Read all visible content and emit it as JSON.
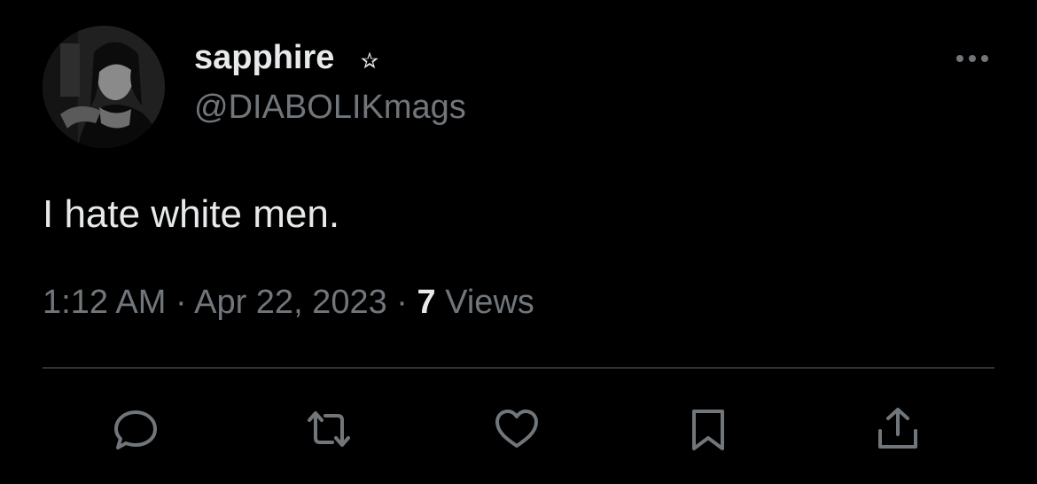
{
  "author": {
    "display_name": "sapphire",
    "display_name_emoji": "star-icon",
    "handle": "@DIABOLIKmags"
  },
  "tweet": {
    "text": "I hate white men.",
    "time": "1:12 AM",
    "separator_1": "·",
    "date": "Apr 22, 2023",
    "separator_2": "·",
    "views_count": "7",
    "views_label": "Views"
  },
  "actions": [
    "reply-icon",
    "retweet-icon",
    "like-icon",
    "bookmark-icon",
    "share-icon"
  ],
  "colors": {
    "background": "#000000",
    "primary_text": "#e7e9ea",
    "secondary_text": "#71767b",
    "divider": "#2f3336"
  }
}
